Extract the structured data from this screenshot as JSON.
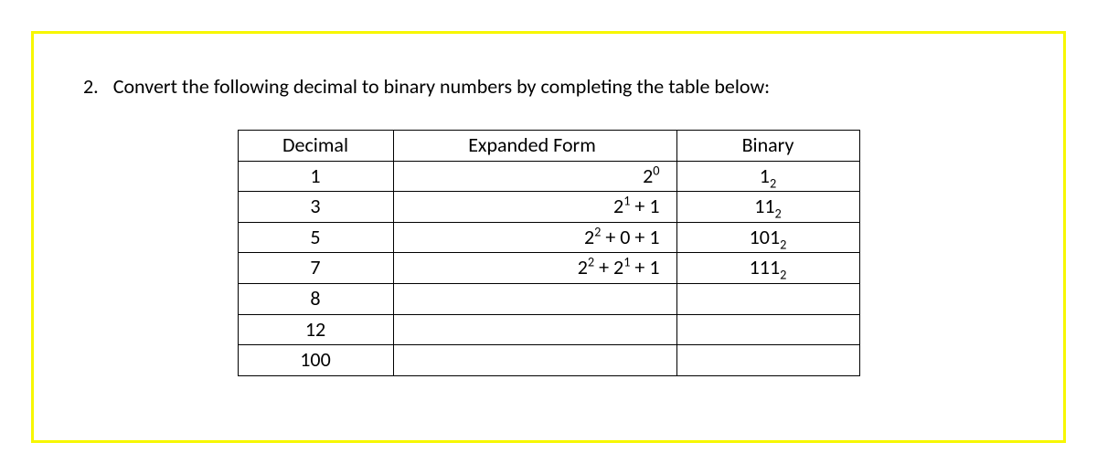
{
  "question": {
    "number": "2.",
    "prompt": "Convert the following decimal to binary numbers by completing the table below:"
  },
  "table": {
    "headers": {
      "decimal": "Decimal",
      "expanded": "Expanded Form",
      "binary": "Binary"
    },
    "rows": [
      {
        "decimal": "1",
        "expanded_html": "2<sup>0</sup>",
        "binary_html": "1<sub>2</sub>"
      },
      {
        "decimal": "3",
        "expanded_html": "2<sup>1</sup> + 1",
        "binary_html": "11<sub>2</sub>"
      },
      {
        "decimal": "5",
        "expanded_html": "2<sup>2</sup> + 0 + 1",
        "binary_html": "101<sub>2</sub>"
      },
      {
        "decimal": "7",
        "expanded_html": "2<sup>2</sup> + 2<sup>1</sup> + 1",
        "binary_html": "111<sub>2</sub>"
      },
      {
        "decimal": "8",
        "expanded_html": "",
        "binary_html": ""
      },
      {
        "decimal": "12",
        "expanded_html": "",
        "binary_html": ""
      },
      {
        "decimal": "100",
        "expanded_html": "",
        "binary_html": ""
      }
    ]
  }
}
